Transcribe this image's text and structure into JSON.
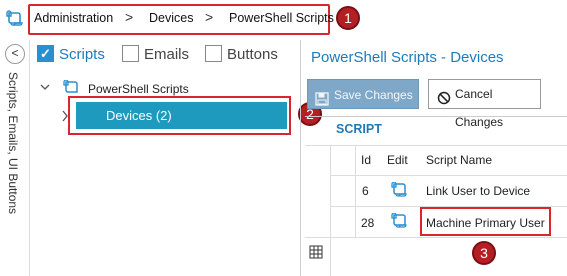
{
  "breadcrumb": {
    "items": [
      "Administration",
      "Devices",
      "PowerShell Scripts"
    ],
    "separator": ">"
  },
  "badges": [
    "1",
    "2",
    "3"
  ],
  "rail": {
    "collapse_glyph": "<",
    "label": "Scripts, Emails, UI Buttons"
  },
  "filters": [
    {
      "label": "Scripts",
      "checked": true
    },
    {
      "label": "Emails",
      "checked": false
    },
    {
      "label": "Buttons",
      "checked": false
    }
  ],
  "tree": {
    "root_label": "PowerShell Scripts",
    "selected_label": "Devices (2)"
  },
  "right": {
    "title": "PowerShell Scripts - Devices",
    "save_label": "Save Changes",
    "cancel_label": "Cancel Changes",
    "grid_title": "SCRIPT",
    "columns": [
      "Id",
      "Edit",
      "Script Name"
    ],
    "rows": [
      {
        "id": "6",
        "name": "Link User to Device"
      },
      {
        "id": "28",
        "name": "Machine Primary User"
      }
    ]
  },
  "colors": {
    "accent": "#1f7bb8",
    "selected_node": "#1e9abe",
    "highlight": "#d9262c",
    "badge": "#b31f24"
  },
  "icons": [
    "script-icon",
    "chevron-right-icon",
    "chevron-left-icon",
    "checkbox-icon",
    "save-icon",
    "cancel-icon",
    "edit-script-icon",
    "grid-settings-icon"
  ]
}
